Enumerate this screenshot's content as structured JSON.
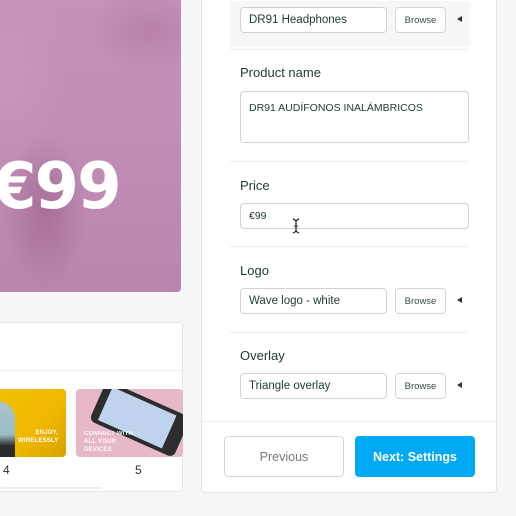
{
  "preview": {
    "price_text": "€99",
    "accent_color": "#c08db6"
  },
  "thumbnails": {
    "items": [
      {
        "number": "4",
        "caption": "ENJOY, WIRELESSLY",
        "bg_color": "#f3c200"
      },
      {
        "number": "5",
        "caption": "CONNECT WITH ALL YOUR DEVICES",
        "bg_color": "#e7b8c9"
      }
    ]
  },
  "form": {
    "image_field": {
      "value": "DR91 Headphones",
      "browse_label": "Browse"
    },
    "product_name": {
      "label": "Product name",
      "value": "DR91 AUDÍFONOS INALÁMBRICOS"
    },
    "price": {
      "label": "Price",
      "value": "€99"
    },
    "logo": {
      "label": "Logo",
      "value": "Wave logo - white",
      "browse_label": "Browse"
    },
    "overlay": {
      "label": "Overlay",
      "value": "Triangle overlay",
      "browse_label": "Browse"
    }
  },
  "footer": {
    "previous_label": "Previous",
    "next_label": "Next: Settings",
    "next_color": "#00a9f4"
  }
}
